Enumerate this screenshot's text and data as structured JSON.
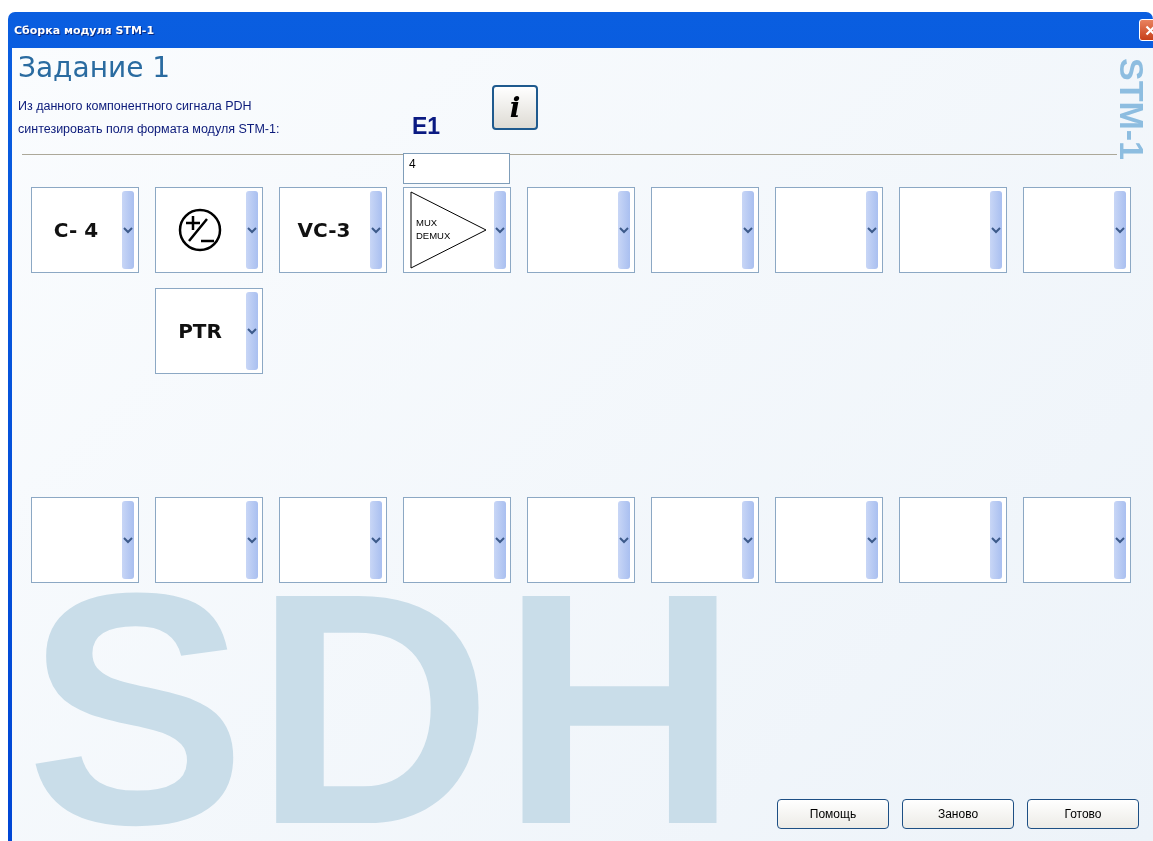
{
  "window": {
    "title": "Сборка модуля STM-1"
  },
  "heading": "Задание 1",
  "instruction_lines": [
    "Из данного компонентного сигнала PDH",
    "синтезировать поля формата модуля STM-1:"
  ],
  "signal": "E1",
  "info_button": "i",
  "side_text": "STM-1",
  "background_text": "SDH",
  "upper_columns": [
    {
      "slots": [
        {
          "kind": "text",
          "label": "C- 4"
        }
      ]
    },
    {
      "slots": [
        {
          "kind": "sign"
        },
        {
          "kind": "text",
          "label": "PTR"
        }
      ]
    },
    {
      "slots": [
        {
          "kind": "text",
          "label": "VC-3"
        }
      ]
    },
    {
      "field": "4",
      "slots": [
        {
          "kind": "mux",
          "labels": [
            "MUX",
            "DEMUX"
          ]
        }
      ]
    },
    {
      "slots": [
        {
          "kind": "empty"
        }
      ]
    },
    {
      "slots": [
        {
          "kind": "empty"
        }
      ]
    },
    {
      "slots": [
        {
          "kind": "empty"
        }
      ]
    },
    {
      "slots": [
        {
          "kind": "empty"
        }
      ]
    },
    {
      "slots": [
        {
          "kind": "empty"
        }
      ]
    }
  ],
  "lower_slots": [
    {
      "kind": "empty"
    },
    {
      "kind": "empty"
    },
    {
      "kind": "empty"
    },
    {
      "kind": "empty"
    },
    {
      "kind": "empty"
    },
    {
      "kind": "empty"
    },
    {
      "kind": "empty"
    },
    {
      "kind": "empty"
    },
    {
      "kind": "empty"
    }
  ],
  "buttons": [
    "Помощь",
    "Заново",
    "Готово"
  ]
}
